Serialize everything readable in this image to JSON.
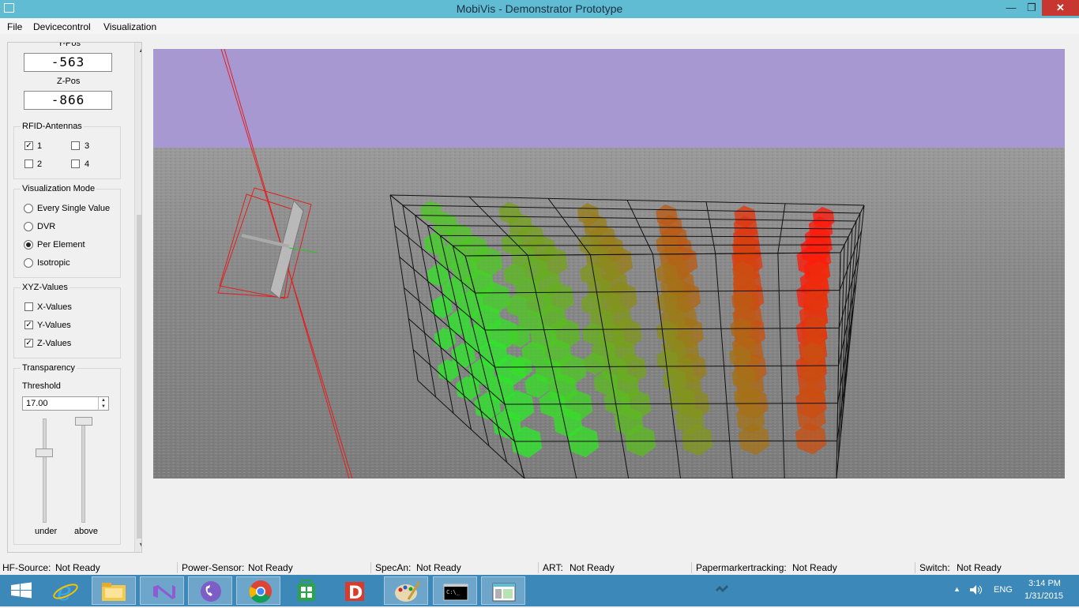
{
  "window": {
    "title": "MobiVis - Demonstrator Prototype",
    "min_glyph": "—",
    "max_glyph": "❐",
    "close_glyph": "✕"
  },
  "menu": {
    "file": "File",
    "devicecontrol": "Devicecontrol",
    "visualization": "Visualization"
  },
  "panel": {
    "ypos_label": "Y-Pos",
    "ypos_value": "-563",
    "zpos_label": "Z-Pos",
    "zpos_value": "-866",
    "rfid": {
      "title": "RFID-Antennas",
      "antennas": [
        {
          "label": "1",
          "checked": true
        },
        {
          "label": "3",
          "checked": false
        },
        {
          "label": "2",
          "checked": false
        },
        {
          "label": "4",
          "checked": false
        }
      ]
    },
    "vis_mode": {
      "title": "Visualization Mode",
      "options": [
        "Every Single  Value",
        "DVR",
        "Per Element",
        "Isotropic"
      ],
      "selected": "Per Element"
    },
    "xyz": {
      "title": "XYZ-Values",
      "items": [
        {
          "label": "X-Values",
          "checked": false
        },
        {
          "label": "Y-Values",
          "checked": true
        },
        {
          "label": "Z-Values",
          "checked": true
        }
      ]
    },
    "transparency": {
      "title": "Transparency",
      "threshold_label": "Threshold",
      "threshold_value": "17.00",
      "under_label": "under",
      "above_label": "above",
      "under_level": 0.67,
      "above_level": 1.0
    },
    "check_glyph": "✓"
  },
  "status": {
    "hf_source": {
      "label": "HF-Source:",
      "value": "Not Ready"
    },
    "power_sensor": {
      "label": "Power-Sensor:",
      "value": "Not Ready"
    },
    "specan": {
      "label": "SpecAn:",
      "value": "Not Ready"
    },
    "art": {
      "label": "ART:",
      "value": "Not Ready"
    },
    "papermarker": {
      "label": "Papermarkertracking:",
      "value": "Not Ready"
    },
    "switch": {
      "label": "Switch:",
      "value": "Not Ready"
    }
  },
  "scene": {
    "sky_color": "#a898d2",
    "ground_color": "#8c8c8c",
    "low_color": "#2ee62a",
    "high_color": "#ff1a0a"
  },
  "taskbar": {
    "apps": [
      "windows-start",
      "internet-explorer",
      "file-explorer",
      "visual-studio",
      "viber",
      "chrome",
      "store",
      "d-app",
      "paint",
      "command-prompt",
      "mobivis"
    ],
    "language": "ENG",
    "time": "3:14 PM",
    "date": "1/31/2015"
  }
}
